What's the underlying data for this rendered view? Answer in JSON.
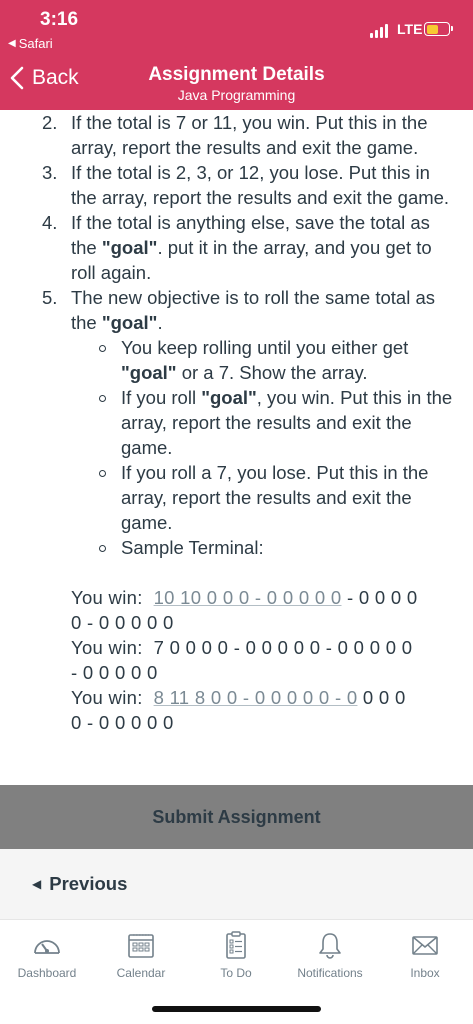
{
  "status_bar": {
    "time": "3:16",
    "back_app": "Safari",
    "network": "LTE",
    "battery_color": "#f7c932"
  },
  "nav": {
    "back_label": "Back",
    "title": "Assignment Details",
    "subtitle": "Java Programming",
    "color": "#d5385f"
  },
  "content": {
    "items": [
      {
        "num": "2.",
        "parts": [
          "If the total is 7 or 11, you win. Put this in the array, report the results and exit the game."
        ]
      },
      {
        "num": "3.",
        "parts": [
          "If the total is 2, 3, or 12, you lose. Put this in the array, report the results and exit the game."
        ]
      },
      {
        "num": "4.",
        "pre": "If the total is anything else, save the total as the ",
        "bold": "\"goal\"",
        "post": ". put it in the array, and you get to roll again."
      },
      {
        "num": "5.",
        "pre": "The new objective is to roll the same total as the ",
        "bold": "\"goal\"",
        "post": "."
      }
    ],
    "sub_items": [
      {
        "pre": "You keep rolling until you either get ",
        "bold": "\"goal\"",
        "post": " or a 7. Show the array."
      },
      {
        "pre": "If you roll ",
        "bold": "\"goal\"",
        "post": ", you win. Put this in the array, report the results and exit the game."
      },
      {
        "pre": "If you roll a 7, you lose. Put this in the array, report the results and exit the game.",
        "bold": "",
        "post": ""
      },
      {
        "pre": "Sample Terminal:",
        "bold": "",
        "post": ""
      }
    ],
    "terminal": [
      {
        "label": "You win:",
        "underlined": "10 10 0 0 0 - 0 0 0 0 0",
        "rest": " - 0 0 0 0",
        "line2": "0 - 0 0 0 0 0"
      },
      {
        "label": "You win:",
        "underlined": "",
        "rest": "7 0 0 0 0 - 0 0 0 0 0 - 0 0 0 0 0",
        "line2": "- 0 0 0 0 0"
      },
      {
        "label": "You win:",
        "underlined": "8 11 8 0 0 - 0 0 0 0 0 - 0",
        "rest": " 0 0 0",
        "line2": "0 - 0 0 0 0 0"
      }
    ]
  },
  "submit_label": "Submit Assignment",
  "previous_label": "Previous",
  "tabs": [
    {
      "label": "Dashboard",
      "icon": "dashboard-icon"
    },
    {
      "label": "Calendar",
      "icon": "calendar-icon"
    },
    {
      "label": "To Do",
      "icon": "todo-icon"
    },
    {
      "label": "Notifications",
      "icon": "bell-icon"
    },
    {
      "label": "Inbox",
      "icon": "inbox-icon"
    }
  ]
}
